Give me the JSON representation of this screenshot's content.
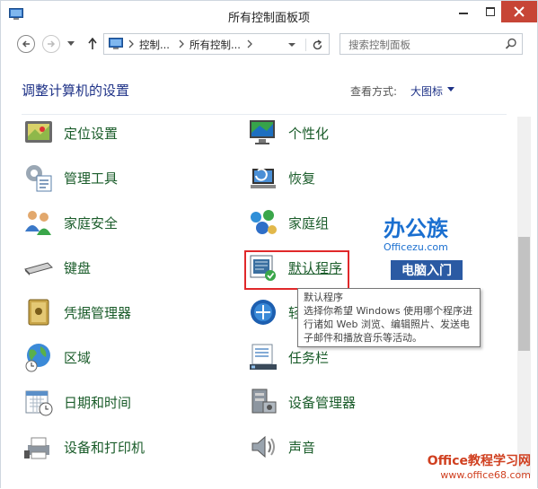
{
  "window": {
    "title": "所有控制面板项"
  },
  "nav": {
    "breadcrumbs": [
      "控制...",
      "所有控制..."
    ],
    "search_placeholder": "搜索控制面板"
  },
  "content": {
    "heading": "调整计算机的设置",
    "view_by_label": "查看方式:",
    "view_by_value": "大图标",
    "items_col1": [
      {
        "label": "定位设置",
        "icon": "location-settings-icon"
      },
      {
        "label": "管理工具",
        "icon": "admin-tools-icon"
      },
      {
        "label": "家庭安全",
        "icon": "family-safety-icon"
      },
      {
        "label": "键盘",
        "icon": "keyboard-icon"
      },
      {
        "label": "凭据管理器",
        "icon": "credential-manager-icon"
      },
      {
        "label": "区域",
        "icon": "region-globe-icon"
      },
      {
        "label": "日期和时间",
        "icon": "date-time-icon"
      },
      {
        "label": "设备和打印机",
        "icon": "devices-printers-icon"
      }
    ],
    "items_col2": [
      {
        "label": "个性化",
        "icon": "personalization-icon"
      },
      {
        "label": "恢复",
        "icon": "recovery-icon"
      },
      {
        "label": "家庭组",
        "icon": "homegroup-icon"
      },
      {
        "label": "默认程序",
        "icon": "default-programs-icon"
      },
      {
        "label": "轻",
        "icon": "ease-of-access-icon"
      },
      {
        "label": "任务栏",
        "icon": "taskbar-icon"
      },
      {
        "label": "设备管理器",
        "icon": "device-manager-icon"
      },
      {
        "label": "声音",
        "icon": "sound-icon"
      }
    ],
    "tooltip": {
      "title": "默认程序",
      "body": "选择你希望 Windows 使用哪个程序进行诸如 Web 浏览、编辑照片、发送电子邮件和播放音乐等活动。"
    }
  },
  "watermark": {
    "line1": "办公族",
    "line1_sub": "Officezu.com",
    "line2": "电脑入门",
    "line3": "Office教程学习网",
    "line4": "www.office68.com"
  },
  "colors": {
    "link": "#1a5c2a",
    "heading": "#1e3287",
    "highlight": "#e0282a",
    "close": "#c74536"
  }
}
